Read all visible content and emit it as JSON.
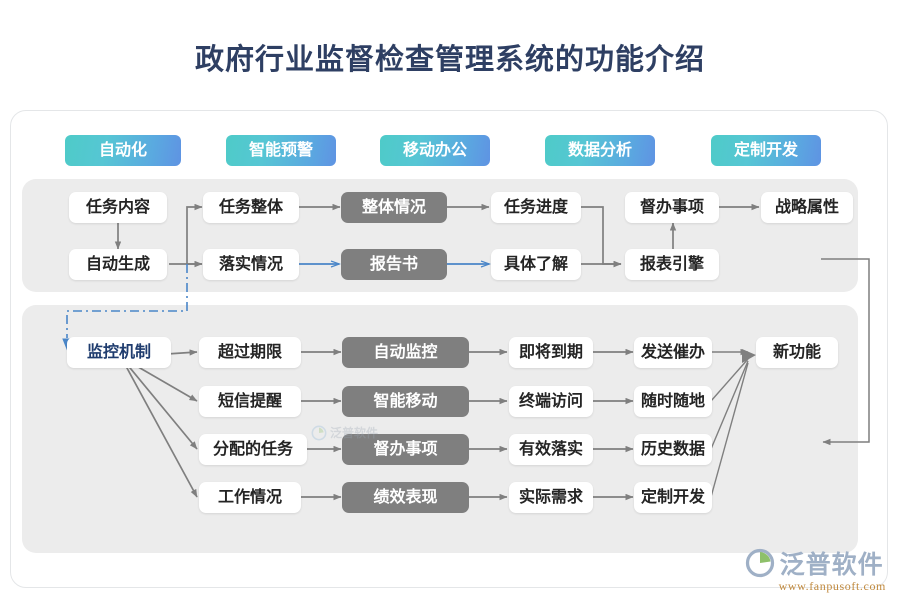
{
  "page": {
    "title": "政府行业监督检查管理系统的功能介绍"
  },
  "colors": {
    "tag_gradient_start": "#4ecbc8",
    "tag_gradient_end": "#5f93e3",
    "gray_node": "#7f7f7f",
    "panel_bg": "#ececec",
    "accent_text": "#1f3c6e",
    "blue_line": "#4a86c8",
    "gray_line": "#7f7f7f",
    "title_color": "#2e3f63"
  },
  "tags": [
    {
      "label": "自动化"
    },
    {
      "label": "智能预警"
    },
    {
      "label": "移动办公"
    },
    {
      "label": "数据分析"
    },
    {
      "label": "定制开发"
    }
  ],
  "panel_top": {
    "nodes": [
      {
        "id": "n_task_content",
        "label": "任务内容",
        "style": "white"
      },
      {
        "id": "n_task_whole",
        "label": "任务整体",
        "style": "white"
      },
      {
        "id": "n_whole_status",
        "label": "整体情况",
        "style": "gray"
      },
      {
        "id": "n_task_progress",
        "label": "任务进度",
        "style": "white"
      },
      {
        "id": "n_supervise_1",
        "label": "督办事项",
        "style": "white"
      },
      {
        "id": "n_strategy",
        "label": "战略属性",
        "style": "white"
      },
      {
        "id": "n_auto_gen",
        "label": "自动生成",
        "style": "white"
      },
      {
        "id": "n_implement",
        "label": "落实情况",
        "style": "white"
      },
      {
        "id": "n_report",
        "label": "报告书",
        "style": "gray"
      },
      {
        "id": "n_detail",
        "label": "具体了解",
        "style": "white"
      },
      {
        "id": "n_report_engine",
        "label": "报表引擎",
        "style": "white"
      }
    ]
  },
  "panel_bottom": {
    "nodes": [
      {
        "id": "n_monitor",
        "label": "监控机制",
        "style": "white accent"
      },
      {
        "id": "n_overdue",
        "label": "超过期限",
        "style": "white"
      },
      {
        "id": "n_auto_monitor",
        "label": "自动监控",
        "style": "gray"
      },
      {
        "id": "n_due_soon",
        "label": "即将到期",
        "style": "white"
      },
      {
        "id": "n_send_urge",
        "label": "发送催办",
        "style": "white"
      },
      {
        "id": "n_new_feature",
        "label": "新功能",
        "style": "white"
      },
      {
        "id": "n_sms",
        "label": "短信提醒",
        "style": "white"
      },
      {
        "id": "n_smart_mobile",
        "label": "智能移动",
        "style": "gray"
      },
      {
        "id": "n_terminal",
        "label": "终端访问",
        "style": "white"
      },
      {
        "id": "n_anytime",
        "label": "随时随地",
        "style": "white"
      },
      {
        "id": "n_assigned",
        "label": "分配的任务",
        "style": "white"
      },
      {
        "id": "n_supervise_2",
        "label": "督办事项",
        "style": "gray"
      },
      {
        "id": "n_effective",
        "label": "有效落实",
        "style": "white"
      },
      {
        "id": "n_history",
        "label": "历史数据",
        "style": "white"
      },
      {
        "id": "n_work_status",
        "label": "工作情况",
        "style": "white"
      },
      {
        "id": "n_performance",
        "label": "绩效表现",
        "style": "gray"
      },
      {
        "id": "n_real_need",
        "label": "实际需求",
        "style": "white"
      },
      {
        "id": "n_custom_dev",
        "label": "定制开发",
        "style": "white"
      }
    ]
  },
  "watermark": {
    "center_text": "泛普软件"
  },
  "logo": {
    "name": "泛普软件",
    "url": "www.fanpusoft.com"
  }
}
